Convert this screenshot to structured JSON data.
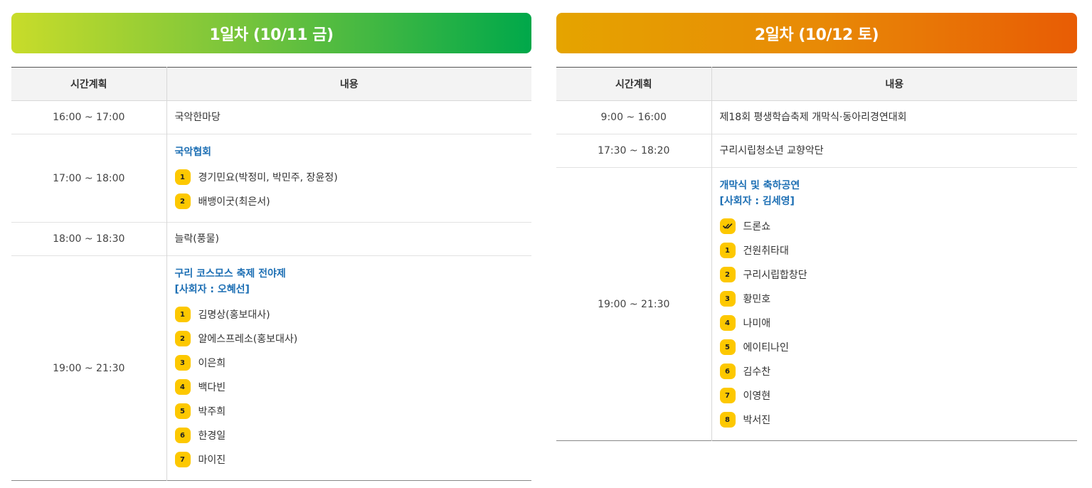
{
  "day1": {
    "title": "1일차 (10/11 금)",
    "header_time": "시간계획",
    "header_content": "내용",
    "rows": [
      {
        "time": "16:00 ~ 17:00",
        "text": "국악한마당"
      },
      {
        "time": "17:00 ~ 18:00",
        "heading": "국악협회",
        "items": [
          {
            "badge": "1",
            "text": "경기민요(박정미, 박민주, 장윤정)"
          },
          {
            "badge": "2",
            "text": "배뱅이굿(최은서)"
          }
        ]
      },
      {
        "time": "18:00 ~ 18:30",
        "text": "늘락(풍물)"
      },
      {
        "time": "19:00 ~ 21:30",
        "heading": "구리 코스모스 축제 전야제",
        "subheading": "[사회자 : 오혜선]",
        "items": [
          {
            "badge": "1",
            "text": "김명상(홍보대사)"
          },
          {
            "badge": "2",
            "text": "알에스프레소(홍보대사)"
          },
          {
            "badge": "3",
            "text": "이은희"
          },
          {
            "badge": "4",
            "text": "백다빈"
          },
          {
            "badge": "5",
            "text": "박주희"
          },
          {
            "badge": "6",
            "text": "한경일"
          },
          {
            "badge": "7",
            "text": "마이진"
          }
        ]
      }
    ]
  },
  "day2": {
    "title": "2일차 (10/12 토)",
    "header_time": "시간계획",
    "header_content": "내용",
    "rows": [
      {
        "time": "9:00 ~ 16:00",
        "text": "제18회 평생학습축제 개막식·동아리경연대회"
      },
      {
        "time": "17:30 ~ 18:20",
        "text": "구리시립청소년 교향악단"
      },
      {
        "time": "19:00 ~ 21:30",
        "heading": "개막식 및 축하공연",
        "subheading": "[사회자 : 김세영]",
        "check_item": "드론쇼",
        "items": [
          {
            "badge": "1",
            "text": "건원취타대"
          },
          {
            "badge": "2",
            "text": "구리시립합창단"
          },
          {
            "badge": "3",
            "text": "황민호"
          },
          {
            "badge": "4",
            "text": "나미애"
          },
          {
            "badge": "5",
            "text": "에이티나인"
          },
          {
            "badge": "6",
            "text": "김수찬"
          },
          {
            "badge": "7",
            "text": "이영현"
          },
          {
            "badge": "8",
            "text": "박서진"
          }
        ]
      }
    ]
  },
  "colors": {
    "heading": "#1d6fb4",
    "badge": "#fdc800",
    "day1_gradient_end": "#00a84a",
    "day2_gradient_end": "#e85c05"
  }
}
